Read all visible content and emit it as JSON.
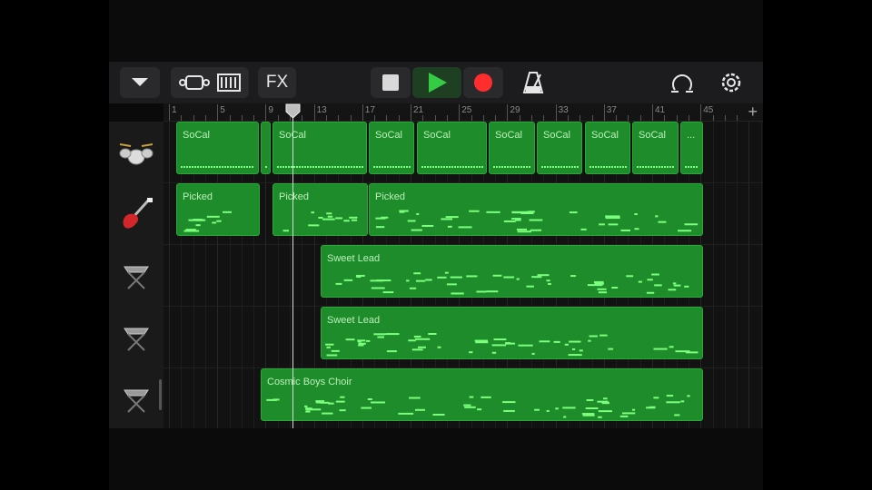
{
  "toolbar": {
    "fx_label": "FX",
    "icons": [
      "chevron-down-icon",
      "tracks-view-icon",
      "mixer-icon",
      "stop-icon",
      "play-icon",
      "record-icon",
      "metronome-icon",
      "loops-icon",
      "settings-icon"
    ]
  },
  "ruler": {
    "markers": [
      "1",
      "5",
      "9",
      "13",
      "17",
      "21",
      "25",
      "29",
      "33",
      "37",
      "41",
      "45"
    ],
    "add_label": "+"
  },
  "tracks": [
    {
      "instrument": "drum-kit-icon",
      "regions": [
        {
          "label": "SoCal"
        },
        {
          "label": ""
        },
        {
          "label": "SoCal"
        },
        {
          "label": "SoCal"
        },
        {
          "label": "SoCal"
        },
        {
          "label": "SoCal"
        },
        {
          "label": "SoCal"
        },
        {
          "label": "SoCal"
        },
        {
          "label": "SoCal"
        },
        {
          "label": "..."
        }
      ]
    },
    {
      "instrument": "electric-guitar-icon",
      "regions": [
        {
          "label": "Picked"
        },
        {
          "label": "Picked"
        },
        {
          "label": "Picked"
        }
      ]
    },
    {
      "instrument": "keyboard-icon",
      "regions": [
        {
          "label": "Sweet Lead"
        }
      ]
    },
    {
      "instrument": "keyboard-icon",
      "regions": [
        {
          "label": "Sweet Lead"
        }
      ]
    },
    {
      "instrument": "keyboard-icon",
      "regions": [
        {
          "label": "Cosmic Boys Choir"
        }
      ]
    }
  ],
  "colors": {
    "region_fill": "#1e8c2a",
    "region_border": "#2aa838",
    "note": "#7cff7c",
    "play": "#33cc44",
    "record": "#ff2d2d"
  }
}
